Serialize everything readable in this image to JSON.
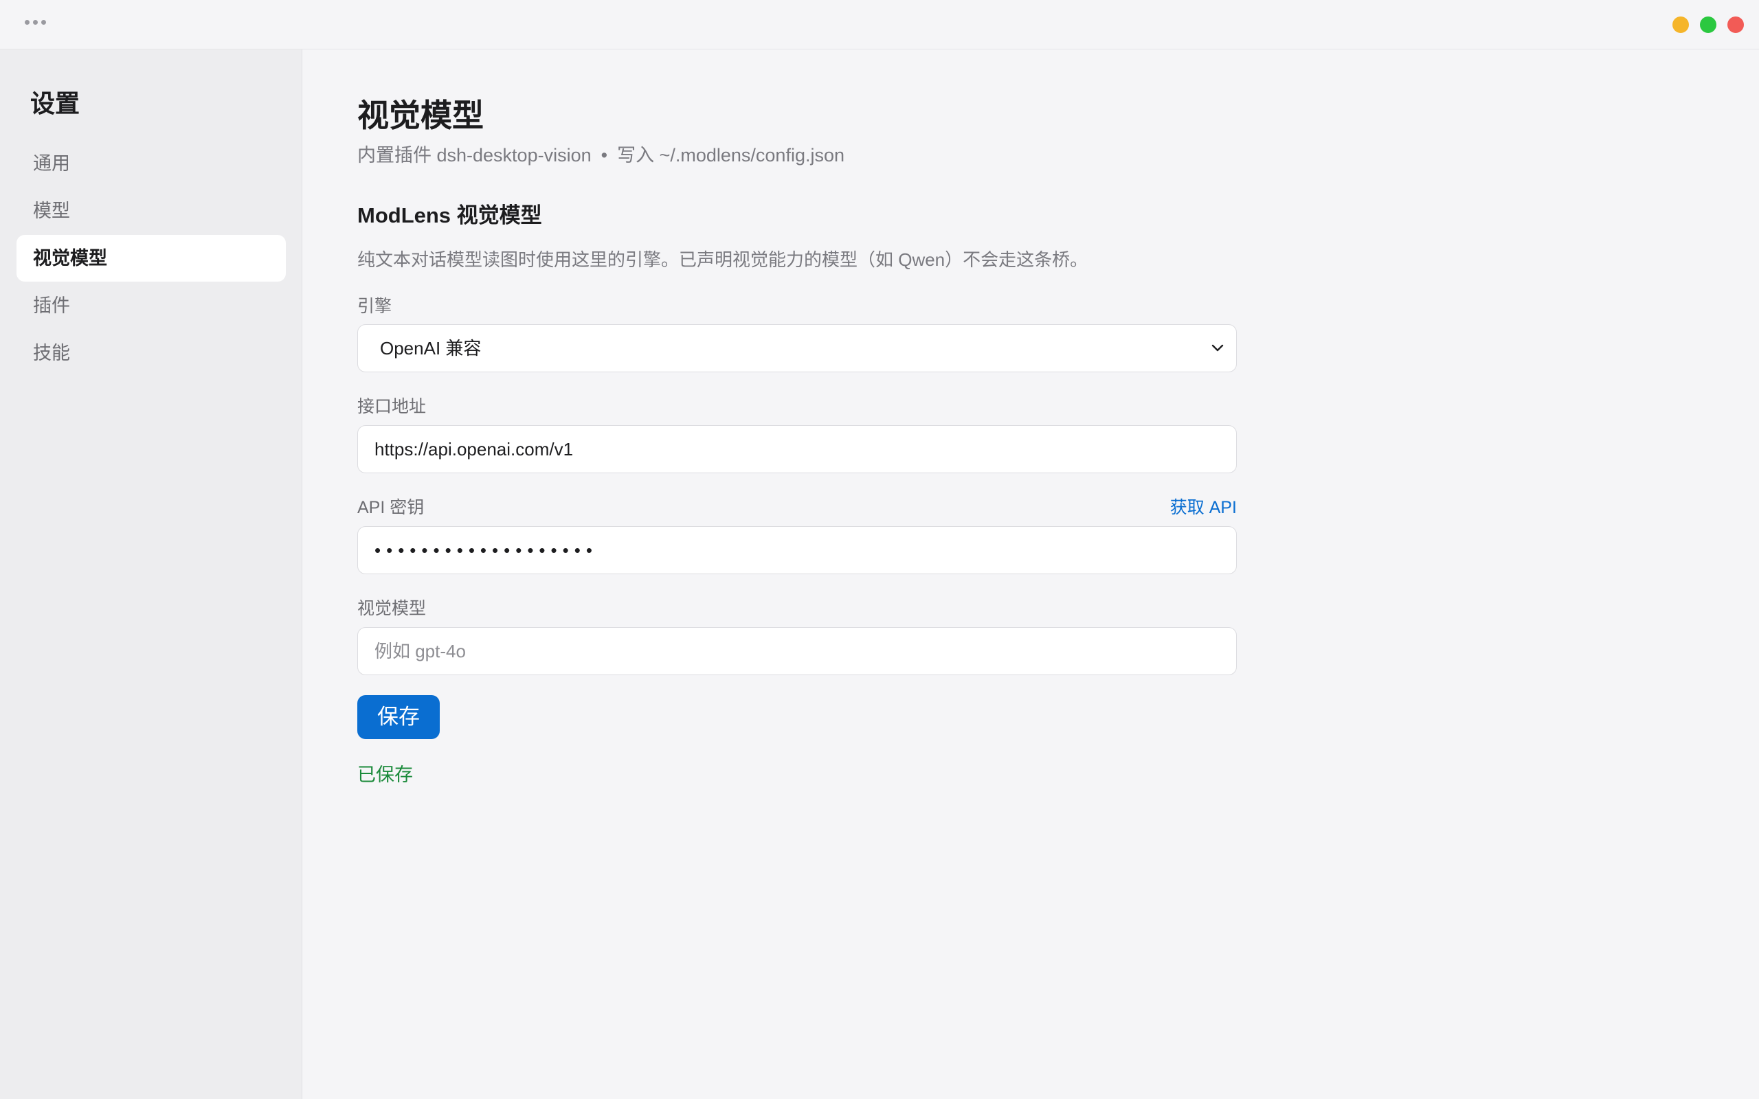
{
  "window": {
    "controls": {
      "minimize_color": "#f5b52a",
      "maximize_color": "#2bc840",
      "close_color": "#f25b56"
    }
  },
  "sidebar": {
    "title": "设置",
    "items": [
      {
        "label": "通用"
      },
      {
        "label": "模型"
      },
      {
        "label": "视觉模型",
        "active": true
      },
      {
        "label": "插件"
      },
      {
        "label": "技能"
      }
    ]
  },
  "main": {
    "title": "视觉模型",
    "subtitle": {
      "plugin": "内置插件 dsh-desktop-vision",
      "separator": "•",
      "path": "写入 ~/.modlens/config.json"
    },
    "section_title": "ModLens 视觉模型",
    "description": "纯文本对话模型读图时使用这里的引擎。已声明视觉能力的模型（如 Qwen）不会走这条桥。",
    "engine": {
      "label": "引擎",
      "value": "OpenAI 兼容"
    },
    "endpoint": {
      "label": "接口地址",
      "value": "https://api.openai.com/v1"
    },
    "api_key": {
      "label": "API 密钥",
      "link": "获取 API",
      "masked": "•••••••••••••••••••"
    },
    "vision_model": {
      "label": "视觉模型",
      "placeholder": "例如 gpt-4o",
      "value": ""
    },
    "save_label": "保存",
    "status": "已保存"
  },
  "colors": {
    "accent": "#0a6ed1",
    "success": "#1a8a3a"
  }
}
